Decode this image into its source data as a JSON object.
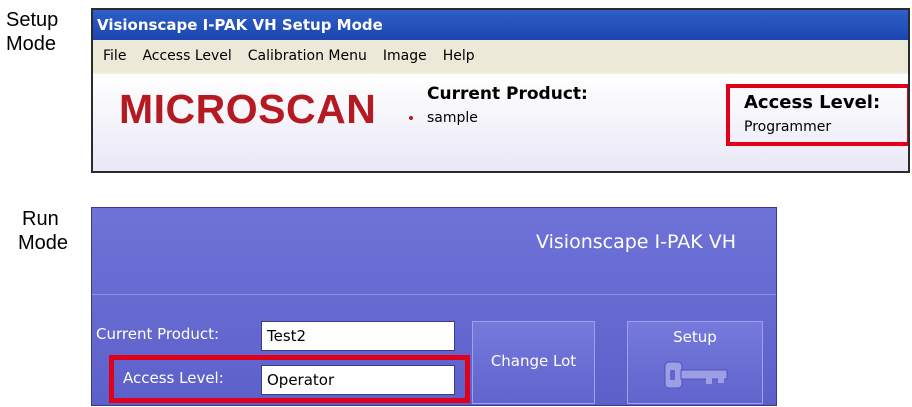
{
  "captions": {
    "setup": [
      "Setup",
      "Mode"
    ],
    "run": [
      "Run",
      "Mode"
    ]
  },
  "setup_window": {
    "title": "Visionscape I-PAK VH  Setup Mode",
    "menu": [
      "File",
      "Access Level",
      "Calibration Menu",
      "Image",
      "Help"
    ],
    "logo_text": "MICROSCAN",
    "current_product_label": "Current Product:",
    "current_product_value": "sample",
    "access_level_label": "Access Level:",
    "access_level_value": "Programmer"
  },
  "run_panel": {
    "title": "Visionscape I-PAK VH",
    "current_product_label": "Current Product:",
    "current_product_value": "Test2",
    "access_level_label": "Access Level:",
    "access_level_value": "Operator",
    "change_lot_label": "Change Lot",
    "setup_label": "Setup",
    "setup_icon": "key-icon"
  },
  "colors": {
    "highlight": "#e1001a",
    "logo": "#b51a22",
    "titlebar": "#2f5fc7",
    "run_background": "#6f73d8"
  }
}
